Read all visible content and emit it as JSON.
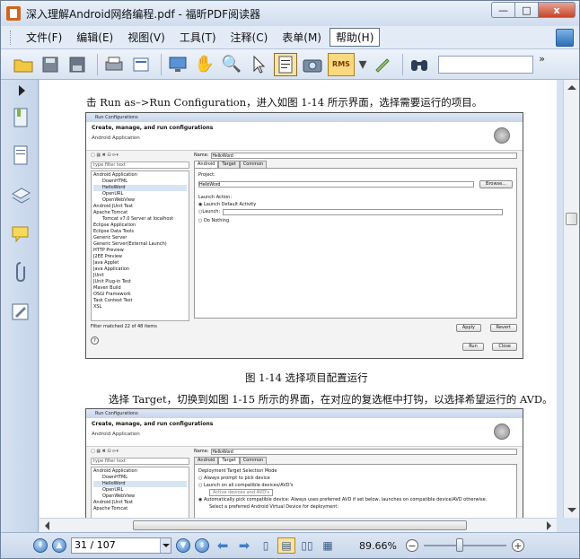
{
  "window": {
    "title": "深入理解Android网络编程.pdf - 福昕PDF阅读器",
    "buttons": {
      "minimize": "—",
      "maximize": "□",
      "close": "x"
    }
  },
  "menu": {
    "items": [
      "文件(F)",
      "编辑(E)",
      "视图(V)",
      "工具(T)",
      "注释(C)",
      "表单(M)",
      "帮助(H)"
    ],
    "active_index": 6
  },
  "toolbar": {
    "overflow": "»",
    "search_placeholder": "",
    "rms_label": "RMS"
  },
  "document": {
    "line1": "击 Run as–>Run Configuration，进入如图 1-14 所示界面，选择需要运行的项目。",
    "caption1": "图 1-14    选择项目配置运行",
    "line2": "选择 Target，切换到如图 1-15 所示的界面，在对应的复选框中打钩，以选择希望运行的 AVD。",
    "shot1": {
      "window_title": "Run Configurations",
      "header_title": "Create, manage, and run configurations",
      "header_sub": "Android Application",
      "filter_placeholder": "type filter text",
      "tree": [
        "Android Application",
        "DownHTML",
        "HelloWord",
        "OpenURL",
        "OpenWebView",
        "Android JUnit Test",
        "Apache Tomcat",
        "Tomcat v7.0 Server at localhost",
        "Eclipse Application",
        "Eclipse Data Tools",
        "Generic Server",
        "Generic Server(External Launch)",
        "HTTP Preview",
        "J2EE Preview",
        "Java Applet",
        "Java Application",
        "JUnit",
        "JUnit Plug-in Test",
        "Maven Build",
        "OSGi Framework",
        "Task Context Test",
        "XSL"
      ],
      "filter_status": "Filter matched 22 of 48 items",
      "name_label": "Name:",
      "name_value": "HelloWord",
      "tabs": [
        "Android",
        "Target",
        "Common"
      ],
      "project_label": "Project:",
      "project_value": "HelloWord",
      "browse": "Browse...",
      "launch_action": "Launch Action:",
      "options": [
        "Launch Default Activity",
        "Launch:",
        "Do Nothing"
      ],
      "apply": "Apply",
      "revert": "Revert",
      "run": "Run",
      "close": "Close",
      "help": "?"
    },
    "shot2": {
      "window_title": "Run Configurations",
      "header_title": "Create, manage, and run configurations",
      "header_sub": "Android Application",
      "filter_placeholder": "type filter text",
      "tree": [
        "Android Application",
        "DownHTML",
        "HelloWord",
        "OpenURL",
        "OpenWebView",
        "Android JUnit Test",
        "Apache Tomcat"
      ],
      "name_label": "Name:",
      "name_value": "HelloWord",
      "tabs": [
        "Android",
        "Target",
        "Common"
      ],
      "mode_title": "Deployment Target Selection Mode",
      "options": [
        "Always prompt to pick device",
        "Launch on all compatible devices/AVD's",
        "Automatically pick compatible device: Always uses preferred AVD if set below, launches on compatible device/AVD otherwise."
      ],
      "dropdown": "Active devices and AVD's",
      "select_note": "Select a preferred Android Virtual Device for deployment:"
    }
  },
  "status": {
    "page_value": "31 / 107",
    "zoom": "89.66%"
  }
}
